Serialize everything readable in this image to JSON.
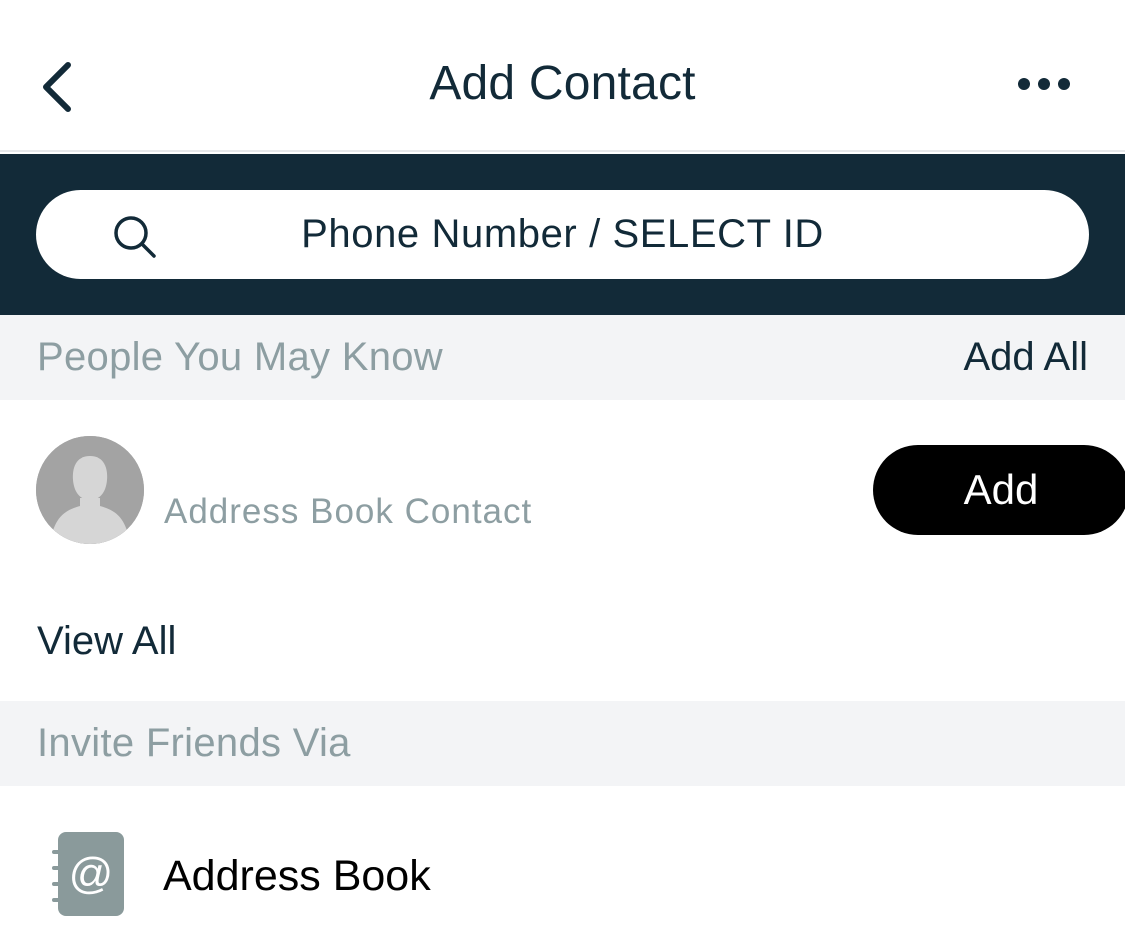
{
  "header": {
    "title": "Add Contact",
    "back_icon": "chevron-left-icon",
    "more_icon": "ellipsis-icon"
  },
  "search": {
    "placeholder": "Phone Number / SELECT ID",
    "value": "",
    "icon": "search-icon"
  },
  "people_section": {
    "label": "People You May Know",
    "add_all_label": "Add All"
  },
  "suggested_contacts": [
    {
      "name": "",
      "subtitle": "Address Book Contact",
      "avatar_icon": "default-avatar-icon",
      "add_label": "Add"
    }
  ],
  "view_all_label": "View All",
  "invite_section": {
    "label": "Invite Friends Via",
    "items": [
      {
        "label": "Address Book",
        "icon": "address-book-icon"
      }
    ]
  },
  "colors": {
    "navy": "#122a38",
    "muted": "#8d9ea2",
    "section_bg": "#f3f4f6",
    "button_bg": "#000000"
  }
}
